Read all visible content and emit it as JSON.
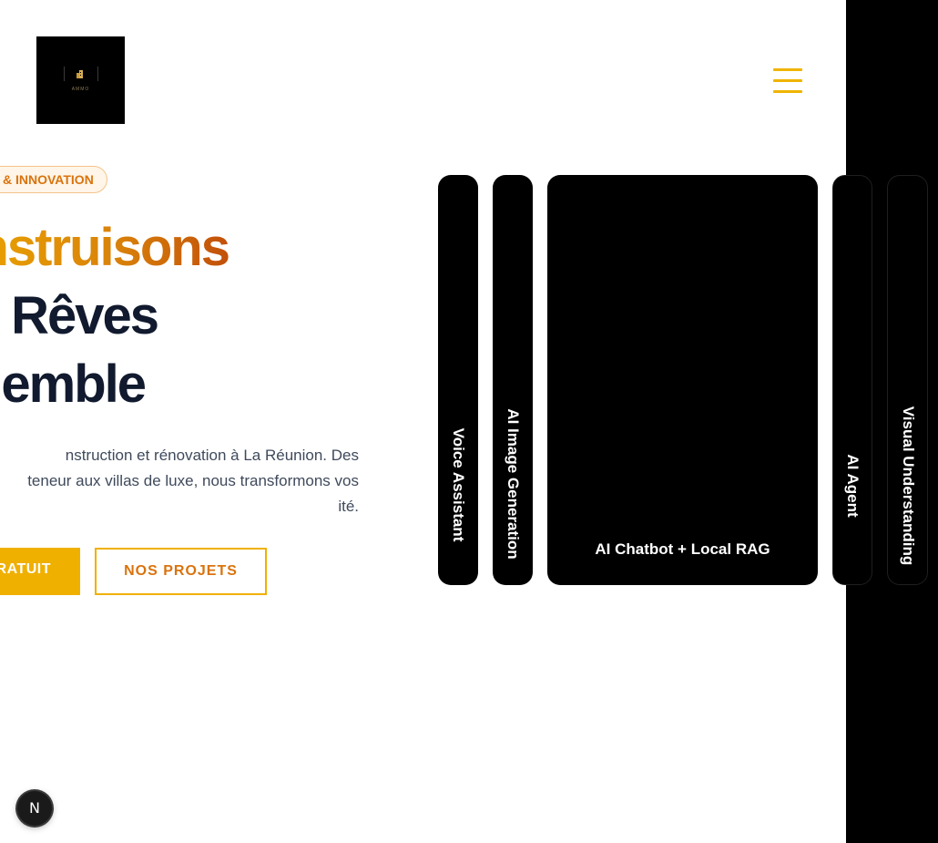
{
  "header": {
    "logo_text": "AMMO",
    "menu_icon": "hamburger-menu-icon",
    "accent_color": "#f0b400"
  },
  "hero": {
    "badge": "& INNOVATION",
    "title_line1": "nstruisons",
    "title_line2": "Rêves",
    "title_line3": "emble",
    "description_line1": "nstruction et rénovation à La Réunion. Des",
    "description_line2": "teneur aux villas de luxe, nous transformons vos",
    "description_line3": "ité.",
    "primary_button": "RATUIT",
    "secondary_button": "NOS PROJETS"
  },
  "cards": [
    {
      "label": "Voice Assistant"
    },
    {
      "label": "AI Image Generation"
    },
    {
      "label": "AI Chatbot + Local RAG"
    },
    {
      "label": "AI Agent"
    },
    {
      "label": "Visual Understanding"
    }
  ],
  "dev_badge": {
    "letter": "N",
    "icon": "nextjs-icon"
  }
}
